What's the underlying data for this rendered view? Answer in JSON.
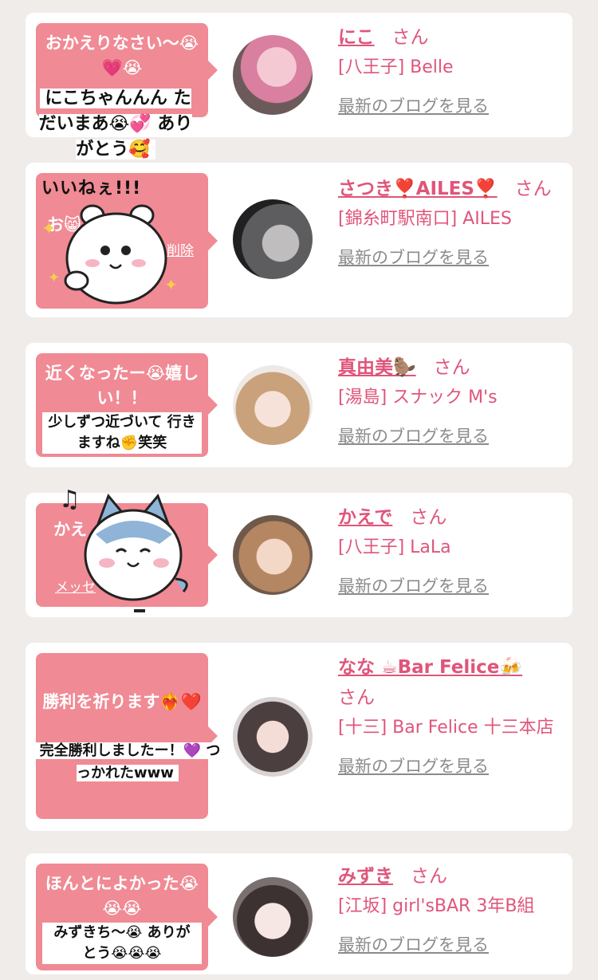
{
  "san_label": "さん",
  "blog_link": "最新のブログを見る",
  "cards": [
    {
      "message": "おかえりなさい〜😭💗😭",
      "reply": "にこちゃんんん ただいまあ😭💞 ありがとう🥰",
      "name": "にこ",
      "shop": "[八王子] Belle"
    },
    {
      "message": "お😸",
      "sticker_text": "いいねぇ!!!",
      "delete": "削除",
      "name": "さつき❣️AILES❣️",
      "shop": "[錦糸町駅南口] AILES"
    },
    {
      "message": "近くなったー😭嬉しい！！",
      "reply": "少しずつ近づいて 行きますね✊笑笑",
      "name": "真由美🦫",
      "shop": "[湯島] スナック M's"
    },
    {
      "message": "かえ",
      "link": "メッセ",
      "name": "かえで",
      "shop": "[八王子] LaLa"
    },
    {
      "message": "勝利を祈ります❤️‍🔥❤️",
      "reply": "完全勝利しましたー！💜 つっかれたwww",
      "name": "なな ☕Bar Felice🍻",
      "shop": "[十三] Bar Felice 十三本店"
    },
    {
      "message": "ほんとによかった😭😭😭",
      "reply": "みずきち〜😭 ありがとう😭😭😭",
      "name": "みずき",
      "shop": "[江坂] girl'sBAR 3年B組"
    }
  ],
  "colors": {
    "accent": "#e0557a",
    "bubble": "#f08a94",
    "link_gray": "#8b8b8b"
  }
}
